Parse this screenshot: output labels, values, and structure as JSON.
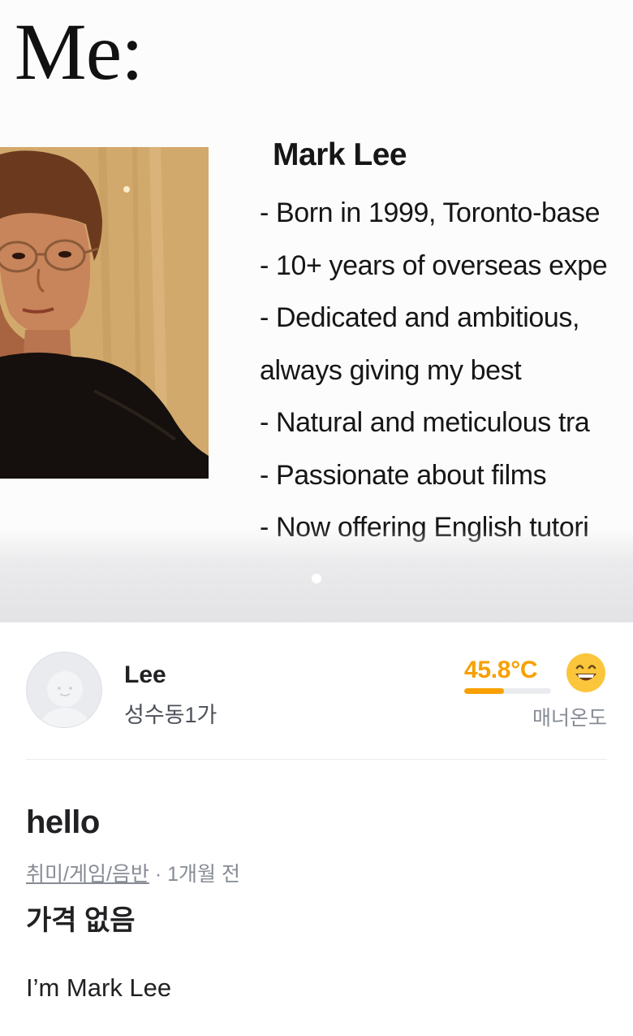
{
  "carousel": {
    "slide_title": "ut Me:",
    "name": "Mark Lee",
    "lines": [
      "-  Born in 1999, Toronto-base",
      "-  10+ years of overseas expe",
      "-  Dedicated and ambitious,",
      "always giving my best",
      "-  Natural and meticulous tra",
      "-  Passionate about films",
      "-  Now offering English tutori"
    ],
    "page_count": 1,
    "active_page": 1
  },
  "seller": {
    "name": "Lee",
    "location": "성수동1가",
    "manner_temp": "45.8°C",
    "manner_temp_value": 45.8,
    "manner_temp_fraction": 0.46,
    "manner_label": "매너온도",
    "temp_color": "#f7a000",
    "emoji_icon": "grinning-face-icon"
  },
  "post": {
    "title": "hello",
    "category": "취미/게임/음반",
    "separator": " · ",
    "time_ago": "1개월 전",
    "price": "가격 없음",
    "content": "I’m Mark Lee"
  }
}
